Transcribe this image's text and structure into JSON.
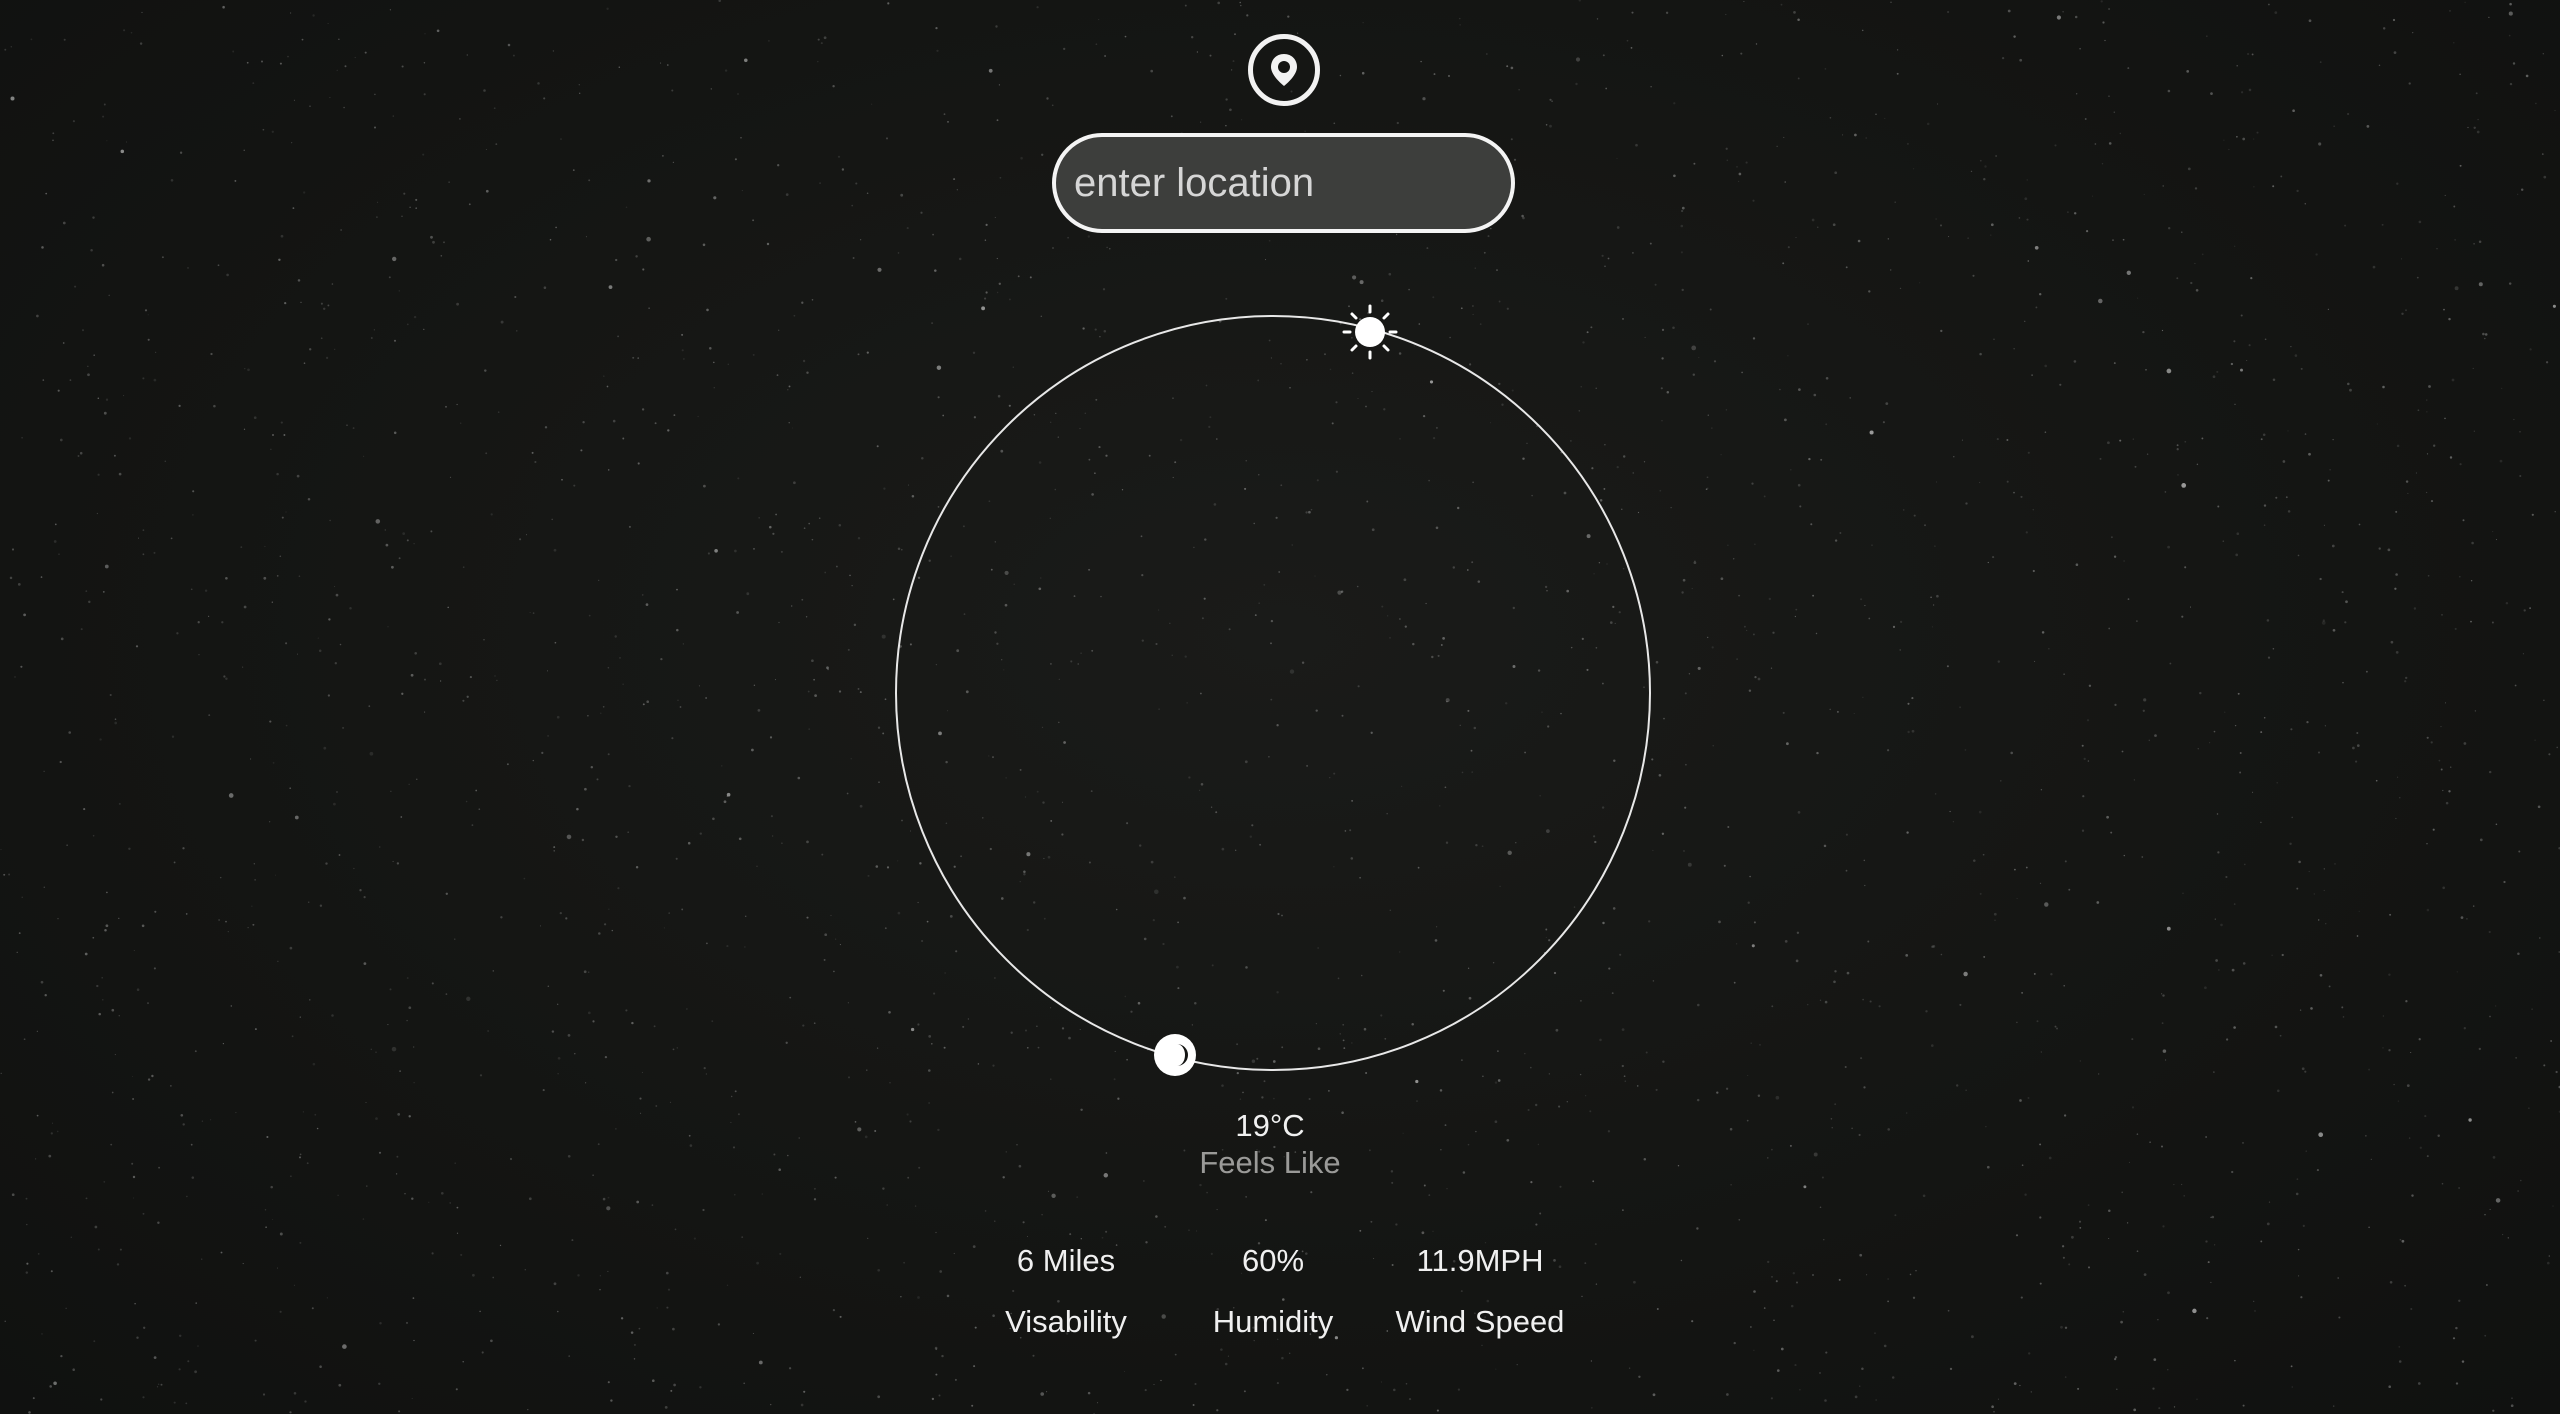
{
  "search": {
    "placeholder": "enter location",
    "icon": "map-pin-icon"
  },
  "orbit": {
    "sun_icon": "sun-icon",
    "moon_icon": "moon-icon"
  },
  "current": {
    "temperature": "19°C",
    "feels_like_label": "Feels Like"
  },
  "stats": [
    {
      "value": "6 Miles",
      "label": "Visability"
    },
    {
      "value": "60%",
      "label": "Humidity"
    },
    {
      "value": "11.9MPH",
      "label": "Wind Speed"
    }
  ],
  "colors": {
    "background": "#141513",
    "foreground": "#f2f2f2",
    "muted": "#9a9a98",
    "input_fill": "#3d3e3c"
  }
}
